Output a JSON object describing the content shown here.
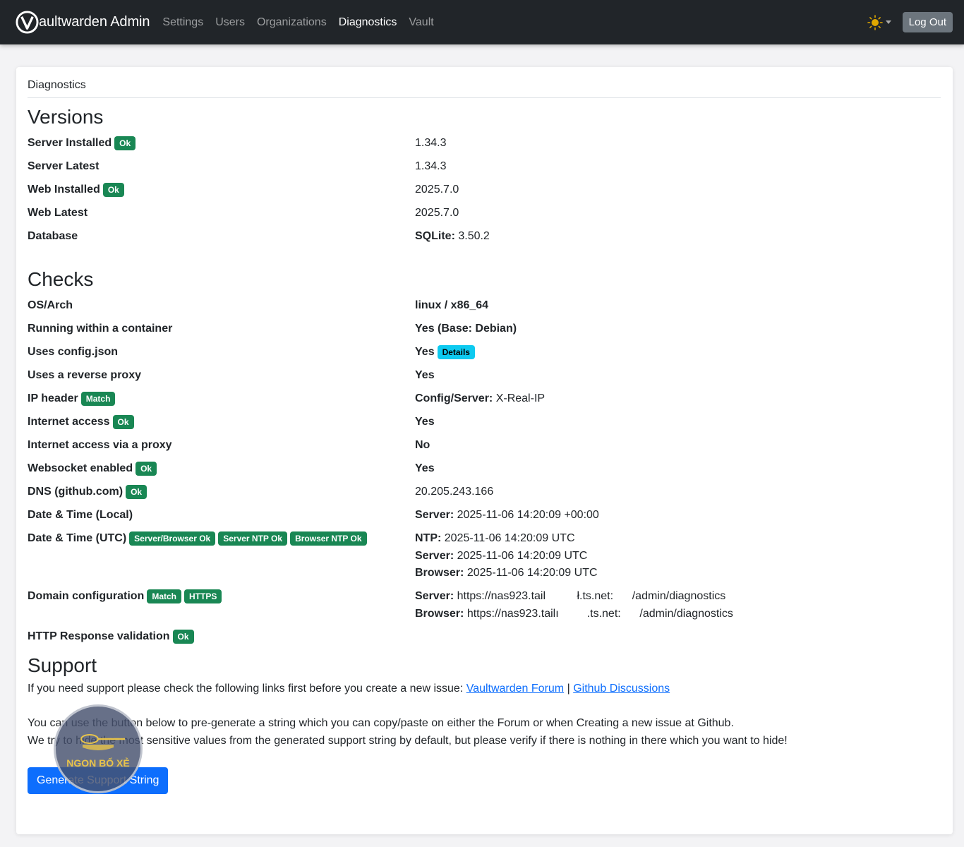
{
  "nav": {
    "brand": "aultwarden Admin",
    "links": [
      "Settings",
      "Users",
      "Organizations",
      "Diagnostics",
      "Vault"
    ],
    "active_link": "Diagnostics",
    "logout_label": "Log Out",
    "theme_icon": "sun-icon"
  },
  "card": {
    "title": "Diagnostics"
  },
  "versions": {
    "heading": "Versions",
    "rows": [
      {
        "label": "Server Installed",
        "badges": [
          "Ok"
        ],
        "value": "1.34.3"
      },
      {
        "label": "Server Latest",
        "badges": [],
        "value": "1.34.3"
      },
      {
        "label": "Web Installed",
        "badges": [
          "Ok"
        ],
        "value": "2025.7.0"
      },
      {
        "label": "Web Latest",
        "badges": [],
        "value": "2025.7.0"
      },
      {
        "label": "Database",
        "badges": [],
        "value_bold": "SQLite:",
        "value": "3.50.2"
      }
    ]
  },
  "checks": {
    "heading": "Checks",
    "os_arch": {
      "label": "OS/Arch",
      "value": "linux / x86_64"
    },
    "container": {
      "label": "Running within a container",
      "value": "Yes (Base: Debian)"
    },
    "config_json": {
      "label": "Uses config.json",
      "value": "Yes",
      "badge": "Details"
    },
    "reverse_proxy": {
      "label": "Uses a reverse proxy",
      "value": "Yes"
    },
    "ip_header": {
      "label": "IP header",
      "badge": "Match",
      "value_bold": "Config/Server:",
      "value": "X-Real-IP"
    },
    "internet": {
      "label": "Internet access",
      "badge": "Ok",
      "value": "Yes"
    },
    "internet_proxy": {
      "label": "Internet access via a proxy",
      "value": "No"
    },
    "websocket": {
      "label": "Websocket enabled",
      "badge": "Ok",
      "value": "Yes"
    },
    "dns": {
      "label": "DNS (github.com)",
      "badge": "Ok",
      "value": "20.205.243.166"
    },
    "time_local": {
      "label": "Date & Time (Local)",
      "value_bold": "Server:",
      "value": "2025-11-06 14:20:09 +00:00"
    },
    "time_utc": {
      "label": "Date & Time (UTC)",
      "badges": [
        "Server/Browser Ok",
        "Server NTP Ok",
        "Browser NTP Ok"
      ],
      "lines": [
        {
          "bold": "NTP:",
          "text": "2025-11-06 14:20:09 UTC"
        },
        {
          "bold": "Server:",
          "text": "2025-11-06 14:20:09 UTC"
        },
        {
          "bold": "Browser:",
          "text": "2025-11-06 14:20:09 UTC"
        }
      ]
    },
    "domain": {
      "label": "Domain configuration",
      "badges": [
        "Match",
        "HTTPS"
      ],
      "lines": [
        {
          "bold": "Server:",
          "text": "https://nas923.tail          ł.ts.net:      /admin/diagnostics"
        },
        {
          "bold": "Browser:",
          "text": "https://nas923.tailı         .ts.net:      /admin/diagnostics"
        }
      ]
    },
    "http_validation": {
      "label": "HTTP Response validation",
      "badge": "Ok"
    }
  },
  "support": {
    "heading": "Support",
    "intro": "If you need support please check the following links first before you create a new issue:",
    "forum_link": "Vaultwarden Forum",
    "separator": "|",
    "github_link": "Github Discussions",
    "para1": "You can use the button below to pre-generate a string which you can copy/paste on either the Forum or when Creating a new issue at Github.",
    "para2": "We try to hide the most sensitive values from the generated support string by default, but please verify if there is nothing in there which you want to hide!",
    "button_label": "Generate Support String"
  },
  "watermark": {
    "text": "NGON BỔ XẺ"
  },
  "colors": {
    "navbar": "#212529",
    "success": "#198754",
    "info": "#0dcaf0",
    "primary": "#0d6efd",
    "secondary": "#6c757d"
  }
}
